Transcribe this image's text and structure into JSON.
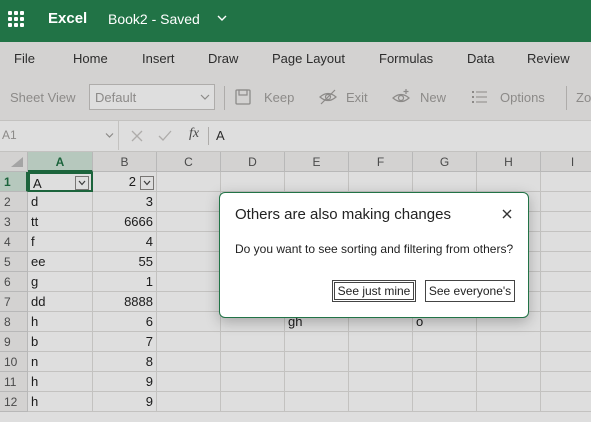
{
  "app": {
    "name": "Excel",
    "doc_title": "Book2 - Saved"
  },
  "tabs": [
    "File",
    "Home",
    "Insert",
    "Draw",
    "Page Layout",
    "Formulas",
    "Data",
    "Review"
  ],
  "ribbon": {
    "sheet_view_label": "Sheet View",
    "view_select_value": "Default",
    "keep_label": "Keep",
    "exit_label": "Exit",
    "new_label": "New",
    "options_label": "Options",
    "zoom_partial": "Zo"
  },
  "formula_bar": {
    "name_box": "A1",
    "fx": "fx",
    "value": "A"
  },
  "columns": [
    "A",
    "B",
    "C",
    "D",
    "E",
    "F",
    "G",
    "H",
    "I"
  ],
  "rows": [
    [
      "A",
      "2",
      "",
      "",
      "",
      "",
      "",
      "",
      ""
    ],
    [
      "d",
      "3",
      "",
      "",
      "",
      "",
      "",
      "",
      ""
    ],
    [
      "tt",
      "6666",
      "",
      "",
      "",
      "",
      "",
      "",
      ""
    ],
    [
      "f",
      "4",
      "",
      "",
      "",
      "",
      "",
      "",
      ""
    ],
    [
      "ee",
      "55",
      "",
      "",
      "",
      "",
      "",
      "",
      ""
    ],
    [
      "g",
      "1",
      "",
      "",
      "",
      "",
      "",
      "",
      ""
    ],
    [
      "dd",
      "8888",
      "",
      "",
      "",
      "",
      "",
      "",
      ""
    ],
    [
      "h",
      "6",
      "",
      "",
      "gh",
      "",
      "o",
      "",
      ""
    ],
    [
      "b",
      "7",
      "",
      "",
      "",
      "",
      "",
      "",
      ""
    ],
    [
      "n",
      "8",
      "",
      "",
      "",
      "",
      "",
      "",
      ""
    ],
    [
      "h",
      "9",
      "",
      "",
      "",
      "",
      "",
      "",
      ""
    ],
    [
      "h",
      "9",
      "",
      "",
      "",
      "",
      "",
      "",
      ""
    ]
  ],
  "dialog": {
    "title": "Others are also making changes",
    "message": "Do you want to see sorting and filtering from others?",
    "primary_button": "See just mine",
    "secondary_button": "See everyone's"
  },
  "colors": {
    "brand": "#217346",
    "selected_header": "#d2e6da"
  }
}
